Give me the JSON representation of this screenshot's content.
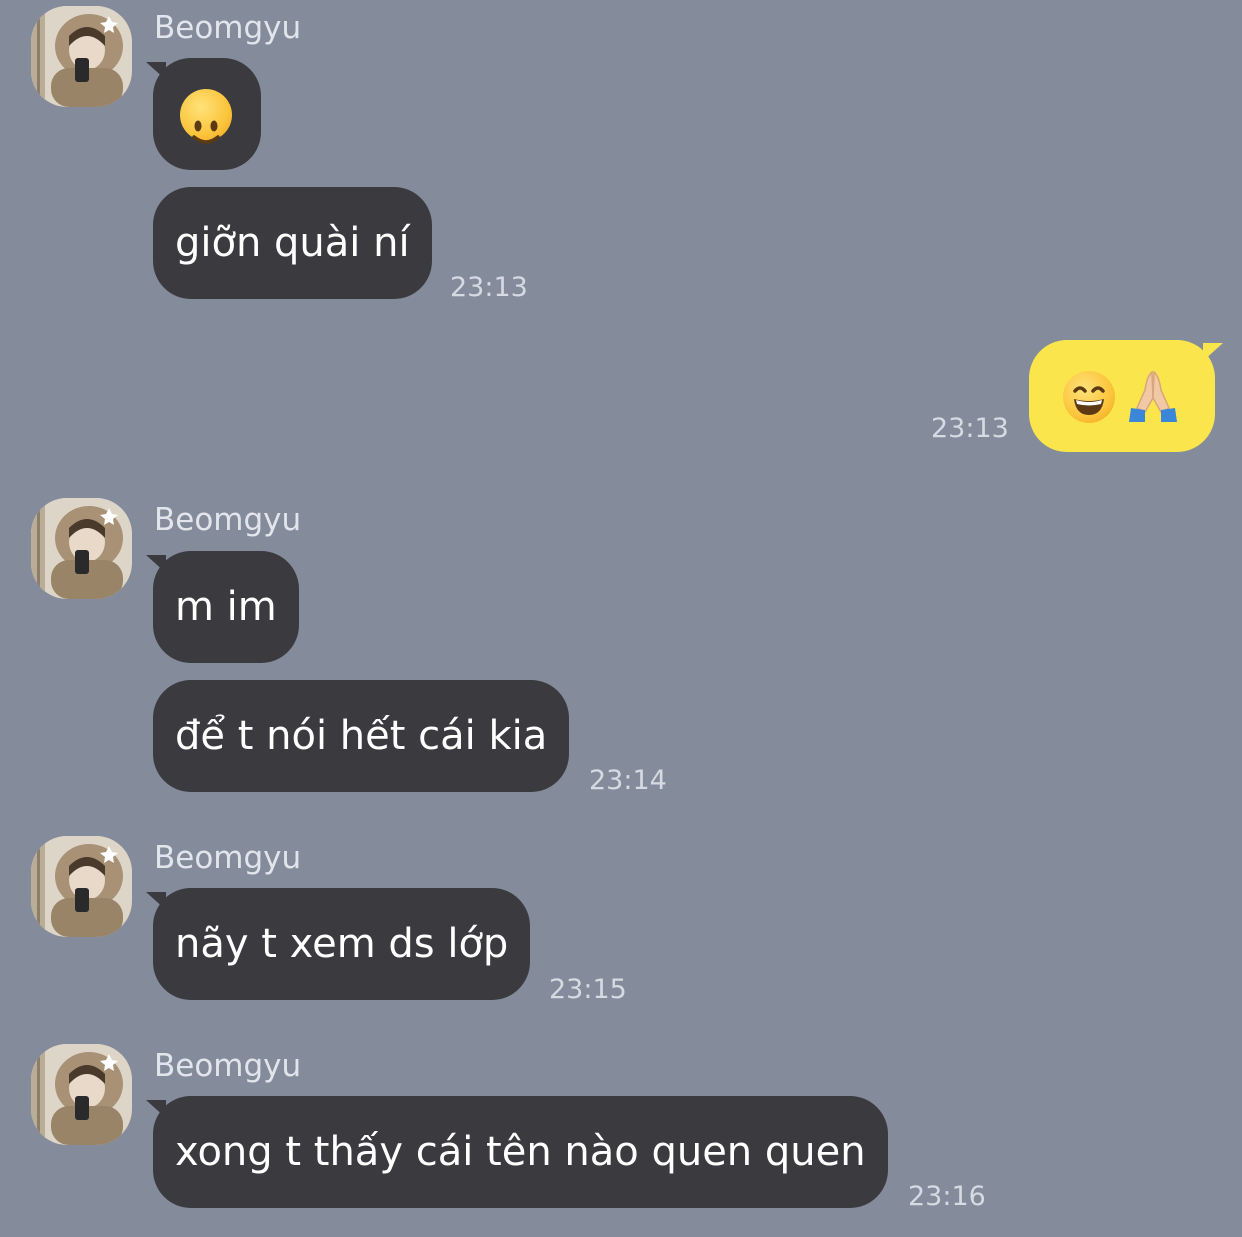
{
  "chat": {
    "messages": [
      {
        "sender": "Beomgyu",
        "texts": [
          "🙂",
          "giỡn quài ní"
        ],
        "time": "23:13"
      },
      {
        "sender": "me",
        "texts": [
          "😄🙏🏼"
        ],
        "time": "23:13"
      },
      {
        "sender": "Beomgyu",
        "texts": [
          "m im",
          "để t nói hết cái kia"
        ],
        "time": "23:14"
      },
      {
        "sender": "Beomgyu",
        "texts": [
          "nãy t xem ds lớp"
        ],
        "time": "23:15"
      },
      {
        "sender": "Beomgyu",
        "texts": [
          "xong t thấy cái tên nào quen quen"
        ],
        "time": "23:16"
      }
    ]
  },
  "icons": {
    "avatar": "profile-photo",
    "slight-smile": "slightly-smiling-face-emoji",
    "grin": "grinning-face-with-smiling-eyes-emoji",
    "pray": "folded-hands-emoji"
  },
  "colors": {
    "background": "#848b9b",
    "incoming_bubble": "#3b3b3f",
    "outgoing_bubble": "#fae54d",
    "name_text": "#e2e5ec",
    "time_text": "#d6dae2"
  }
}
